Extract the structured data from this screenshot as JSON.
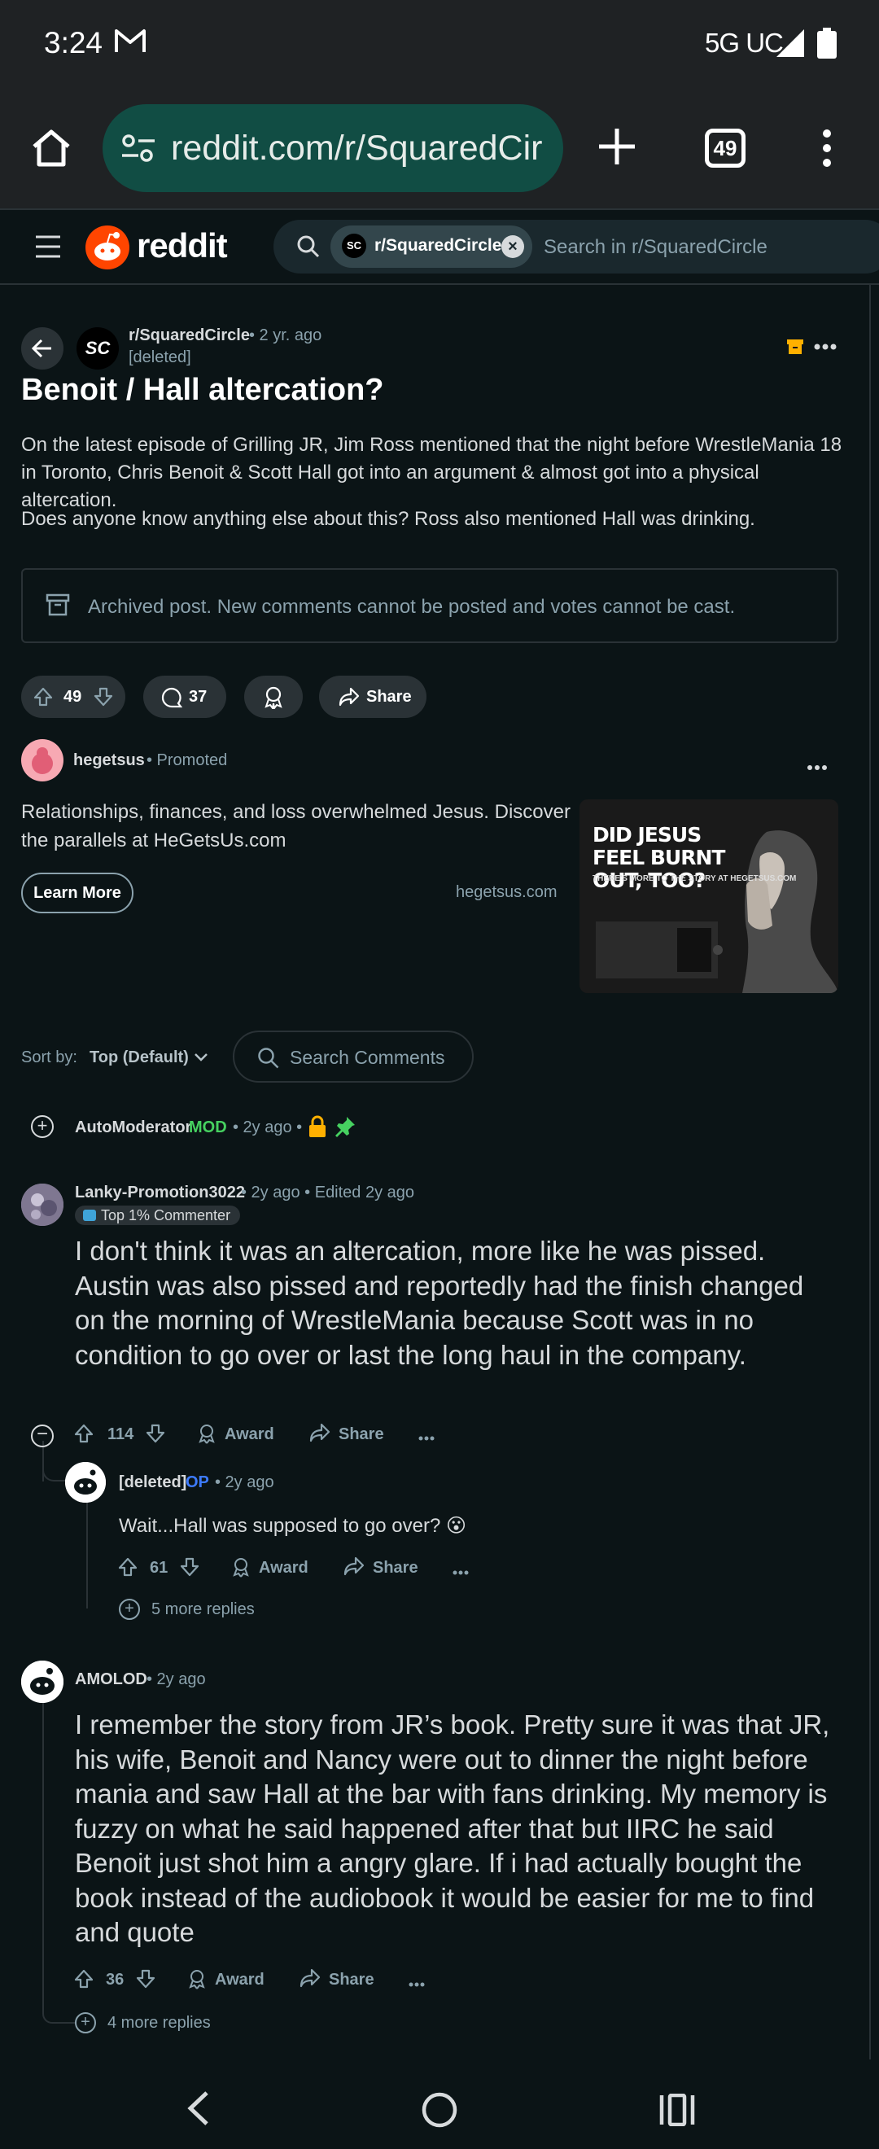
{
  "status_bar": {
    "time": "3:24",
    "network": "5G UC"
  },
  "browser": {
    "url": "reddit.com/r/SquaredCir",
    "tab_count": "49"
  },
  "header": {
    "wordmark": "reddit",
    "subreddit_chip": "r/SquaredCircle",
    "search_placeholder": "Search in r/SquaredCircle"
  },
  "post": {
    "subreddit": "r/SquaredCircle",
    "time": "• 2 yr. ago",
    "author": "[deleted]",
    "title": "Benoit / Hall altercation?",
    "body_1": "On the latest episode of Grilling JR, Jim Ross mentioned that the night before WrestleMania 18 in Toronto, Chris Benoit & Scott Hall got into an argument & almost got into a physical altercation.",
    "body_2": "Does anyone know anything else about this? Ross also mentioned Hall was drinking.",
    "archived_notice": "Archived post. New comments cannot be posted and votes cannot be cast.",
    "votes": "49",
    "comments": "37",
    "share_label": "Share"
  },
  "promoted": {
    "name": "hegetsus",
    "label": "• Promoted",
    "text": "Relationships, finances, and loss overwhelmed Jesus. Discover the parallels at HeGetsUs.com",
    "cta": "Learn More",
    "domain": "hegetsus.com",
    "image_headline": "DID JESUS FEEL BURNT OUT, TOO?",
    "image_sub": "THERE'S MORE TO THE STORY AT HEGETSUS.COM"
  },
  "sort": {
    "label": "Sort by:",
    "value": "Top (Default)",
    "search_placeholder": "Search Comments"
  },
  "comments": {
    "automod": {
      "name": "AutoModerator",
      "flair": "MOD",
      "time": "• 2y ago •"
    },
    "c1": {
      "name": "Lanky-Promotion3022",
      "meta": "• 2y ago • Edited 2y ago",
      "badge": "Top 1% Commenter",
      "text": "I don't think it was an altercation, more like he was pissed. Austin was also pissed and reportedly had the finish changed on the morning of WrestleMania because Scott was in no condition to go over or last the long haul in the company.",
      "votes": "114",
      "award": "Award",
      "share": "Share"
    },
    "c1_reply": {
      "name": "[deleted]",
      "op": "OP",
      "time": "• 2y ago",
      "text": "Wait...Hall was supposed to go over? 😮",
      "votes": "61",
      "award": "Award",
      "share": "Share",
      "more": "5 more replies"
    },
    "c2": {
      "name": "AMOLOD",
      "time": "• 2y ago",
      "text": "I remember the story from JR’s book. Pretty sure it was that JR, his wife, Benoit and Nancy were out to dinner the night before mania and saw Hall at the bar with fans drinking. My memory is fuzzy on what he said happened after that but IIRC he said Benoit just shot him a angry glare. If i had actually bought the book instead of the audiobook it would be easier for me to find and quote",
      "votes": "36",
      "award": "Award",
      "share": "Share",
      "more": "4 more replies"
    }
  },
  "colors": {
    "background": "#0b1416",
    "mod_green": "#46d160",
    "op_blue": "#3d7bff",
    "lock_gold": "#ffb000",
    "url_pill": "#114d44"
  }
}
